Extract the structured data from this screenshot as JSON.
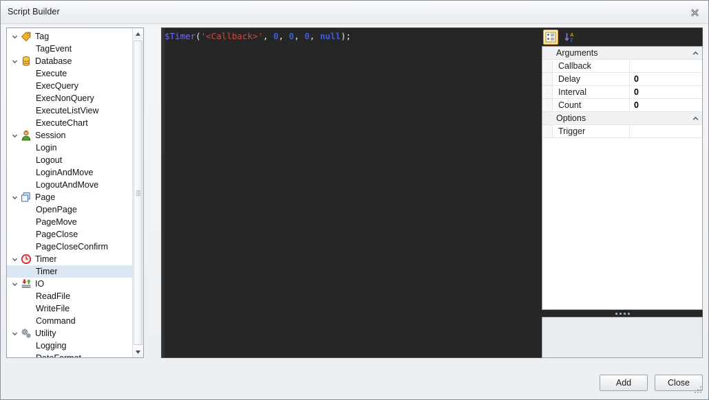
{
  "window": {
    "title": "Script Builder",
    "close_icon": "close-x-icon"
  },
  "tree": {
    "nodes": [
      {
        "label": "Tag",
        "level": 0,
        "icon": "tag-icon",
        "expanded": true
      },
      {
        "label": "TagEvent",
        "level": 1,
        "icon": null
      },
      {
        "label": "Database",
        "level": 0,
        "icon": "database-icon",
        "expanded": true
      },
      {
        "label": "Execute",
        "level": 1,
        "icon": null
      },
      {
        "label": "ExecQuery",
        "level": 1,
        "icon": null
      },
      {
        "label": "ExecNonQuery",
        "level": 1,
        "icon": null
      },
      {
        "label": "ExecuteListView",
        "level": 1,
        "icon": null
      },
      {
        "label": "ExecuteChart",
        "level": 1,
        "icon": null
      },
      {
        "label": "Session",
        "level": 0,
        "icon": "user-icon",
        "expanded": true
      },
      {
        "label": "Login",
        "level": 1,
        "icon": null
      },
      {
        "label": "Logout",
        "level": 1,
        "icon": null
      },
      {
        "label": "LoginAndMove",
        "level": 1,
        "icon": null
      },
      {
        "label": "LogoutAndMove",
        "level": 1,
        "icon": null
      },
      {
        "label": "Page",
        "level": 0,
        "icon": "page-icon",
        "expanded": true
      },
      {
        "label": "OpenPage",
        "level": 1,
        "icon": null
      },
      {
        "label": "PageMove",
        "level": 1,
        "icon": null
      },
      {
        "label": "PageClose",
        "level": 1,
        "icon": null
      },
      {
        "label": "PageCloseConfirm",
        "level": 1,
        "icon": null
      },
      {
        "label": "Timer",
        "level": 0,
        "icon": "timer-icon",
        "expanded": true
      },
      {
        "label": "Timer",
        "level": 1,
        "icon": null,
        "selected": true
      },
      {
        "label": "IO",
        "level": 0,
        "icon": "io-icon",
        "expanded": true
      },
      {
        "label": "ReadFile",
        "level": 1,
        "icon": null
      },
      {
        "label": "WriteFile",
        "level": 1,
        "icon": null
      },
      {
        "label": "Command",
        "level": 1,
        "icon": null
      },
      {
        "label": "Utility",
        "level": 0,
        "icon": "gears-icon",
        "expanded": true
      },
      {
        "label": "Logging",
        "level": 1,
        "icon": null
      },
      {
        "label": "DateFormat",
        "level": 1,
        "icon": null
      }
    ],
    "scrollbar": {
      "up_icon": "triangle-up-icon",
      "down_icon": "triangle-down-icon"
    }
  },
  "editor": {
    "code_tokens": [
      {
        "text": "$Timer",
        "type": "fn"
      },
      {
        "text": "(",
        "type": "punc"
      },
      {
        "text": "'<Callback>'",
        "type": "str"
      },
      {
        "text": ", ",
        "type": "punc"
      },
      {
        "text": "0",
        "type": "num"
      },
      {
        "text": ", ",
        "type": "punc"
      },
      {
        "text": "0",
        "type": "num"
      },
      {
        "text": ", ",
        "type": "punc"
      },
      {
        "text": "0",
        "type": "num"
      },
      {
        "text": ", ",
        "type": "punc"
      },
      {
        "text": "null",
        "type": "kw"
      },
      {
        "text": ");",
        "type": "punc"
      }
    ],
    "plain_text": "$Timer('<Callback>', 0, 0, 0, null);",
    "background_color": "#262626"
  },
  "properties": {
    "toolbar": [
      {
        "icon": "categorized-view-icon",
        "active": true
      },
      {
        "icon": "sort-az-icon",
        "active": false
      }
    ],
    "groups": [
      {
        "name": "Arguments",
        "collapse_icon": "chevron-up-icon",
        "rows": [
          {
            "name": "Callback",
            "value": ""
          },
          {
            "name": "Delay",
            "value": "0"
          },
          {
            "name": "Interval",
            "value": "0"
          },
          {
            "name": "Count",
            "value": "0"
          }
        ]
      },
      {
        "name": "Options",
        "collapse_icon": "chevron-up-icon",
        "rows": [
          {
            "name": "Trigger",
            "value": ""
          }
        ]
      }
    ],
    "description": ""
  },
  "footer": {
    "add_label": "Add",
    "close_label": "Close"
  },
  "colors": {
    "selection": "#dbe7f3",
    "editor_bg": "#262626",
    "accent": "#c9a227"
  }
}
